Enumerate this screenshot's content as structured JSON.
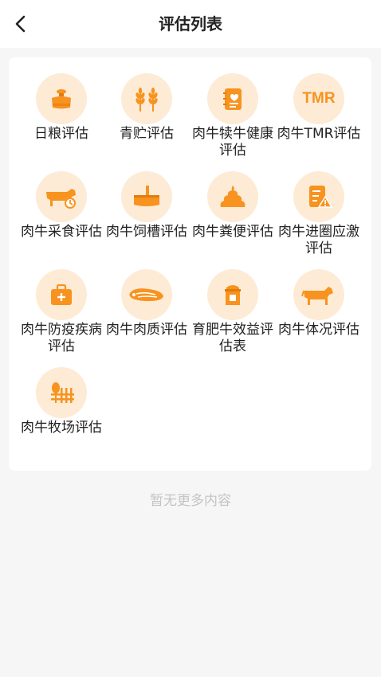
{
  "header": {
    "title": "评估列表"
  },
  "items": [
    {
      "label": "日粮评估",
      "icon": "grain-sack-icon"
    },
    {
      "label": "青贮评估",
      "icon": "wheat-icon"
    },
    {
      "label": "肉牛犊牛健康评估",
      "icon": "notebook-heart-icon"
    },
    {
      "label": "肉牛TMR评估",
      "icon": "tmr-icon",
      "icon_text": "TMR"
    },
    {
      "label": "肉牛采食评估",
      "icon": "cow-clock-icon"
    },
    {
      "label": "肉牛饲槽评估",
      "icon": "feed-trough-icon"
    },
    {
      "label": "肉牛粪便评估",
      "icon": "manure-icon"
    },
    {
      "label": "肉牛进圈应激评估",
      "icon": "checklist-warning-icon"
    },
    {
      "label": "肉牛防疫疾病评估",
      "icon": "medical-kit-icon"
    },
    {
      "label": "肉牛肉质评估",
      "icon": "meat-icon"
    },
    {
      "label": "育肥牛效益评估表",
      "icon": "feed-bin-icon"
    },
    {
      "label": "肉牛体况评估",
      "icon": "cow-icon"
    },
    {
      "label": "肉牛牧场评估",
      "icon": "ranch-fence-icon"
    }
  ],
  "footer": {
    "empty_text": "暂无更多内容"
  },
  "colors": {
    "accent": "#f7931e",
    "icon_bg": "#fdebd6"
  }
}
